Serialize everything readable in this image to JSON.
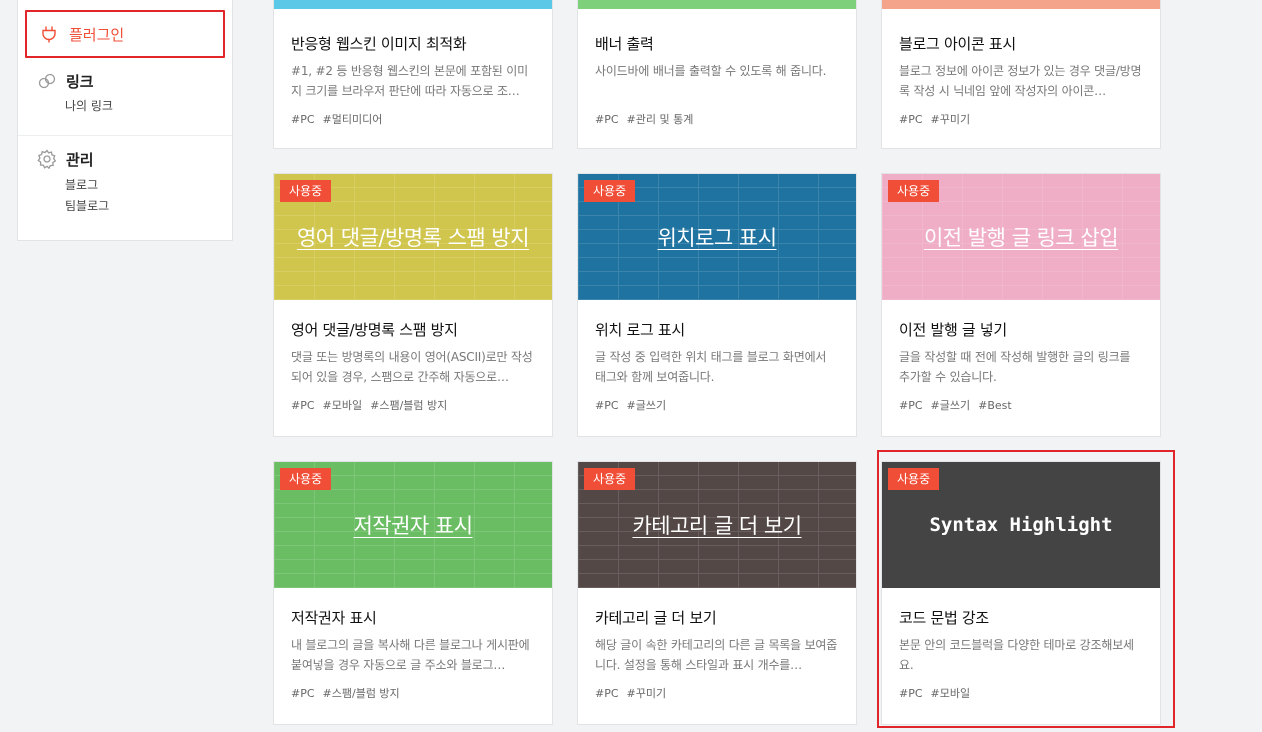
{
  "sidebar": {
    "plugin_label": "플러그인",
    "link_label": "링크",
    "link_subs": [
      "나의 링크"
    ],
    "manage_label": "관리",
    "manage_subs": [
      "블로그",
      "팀블로그"
    ]
  },
  "badge_label": "사용중",
  "colors": {
    "accent": "#f04e37",
    "highlight_border": "#e0262b"
  },
  "cards_top": [
    {
      "title": "반응형 웹스킨 이미지 최적화",
      "desc": "#1, #2 등 반응형 웹스킨의 본문에 포함된 이미지 크기를 브라우저 판단에 따라 자동으로 조…",
      "tags": [
        "#PC",
        "#멀티미디어"
      ],
      "color": "#5ac8e6"
    },
    {
      "title": "배너 출력",
      "desc": "사이드바에 배너를 출력할 수 있도록 해 줍니다.",
      "tags": [
        "#PC",
        "#관리 및 통계"
      ],
      "color": "#7ed17a"
    },
    {
      "title": "블로그 아이콘 표시",
      "desc": "블로그 정보에 아이콘 정보가 있는 경우 댓글/방명록 작성 시 닉네임 앞에 작성자의 아이콘…",
      "tags": [
        "#PC",
        "#꾸미기"
      ],
      "color": "#f5a48c"
    }
  ],
  "cards": [
    {
      "thumb": "영어 댓글/방명록 스팸 방지",
      "title": "영어 댓글/방명록 스팸 방지",
      "desc": "댓글 또는 방명록의 내용이 영어(ASCII)로만 작성되어 있을 경우, 스팸으로 간주해 자동으로…",
      "tags": [
        "#PC",
        "#모바일",
        "#스팸/블럼 방지"
      ],
      "color": "#d1c64d"
    },
    {
      "thumb": "위치로그 표시",
      "title": "위치 로그 표시",
      "desc": "글 작성 중 입력한 위치 태그를 블로그 화면에서 태그와 함께 보여줍니다.",
      "tags": [
        "#PC",
        "#글쓰기"
      ],
      "color": "#1f73a0"
    },
    {
      "thumb": "이전 발행 글 링크 삽입",
      "title": "이전 발행 글 넣기",
      "desc": "글을 작성할 때 전에 작성해 발행한 글의 링크를 추가할 수 있습니다.",
      "tags": [
        "#PC",
        "#글쓰기",
        "#Best"
      ],
      "color": "#efaec6"
    },
    {
      "thumb": "저작권자 표시",
      "title": "저작권자 표시",
      "desc": "내 블로그의 글을 복사해 다른 블로그나 게시판에 붙여넣을 경우 자동으로 글 주소와 블로그…",
      "tags": [
        "#PC",
        "#스팸/블럼 방지"
      ],
      "color": "#6bbd64"
    },
    {
      "thumb": "카테고리 글 더 보기",
      "title": "카테고리 글 더 보기",
      "desc": "해당 글이 속한 카테고리의 다른 글 목록을 보여줍니다. 설정을 통해 스타일과 표시 개수를…",
      "tags": [
        "#PC",
        "#꾸미기"
      ],
      "color": "#544847"
    },
    {
      "thumb": "Syntax Highlight",
      "title": "코드 문법 강조",
      "desc": "본문 안의 코드블럭을 다양한 테마로 강조해보세요.",
      "tags": [
        "#PC",
        "#모바일"
      ],
      "color": "#444444"
    }
  ]
}
